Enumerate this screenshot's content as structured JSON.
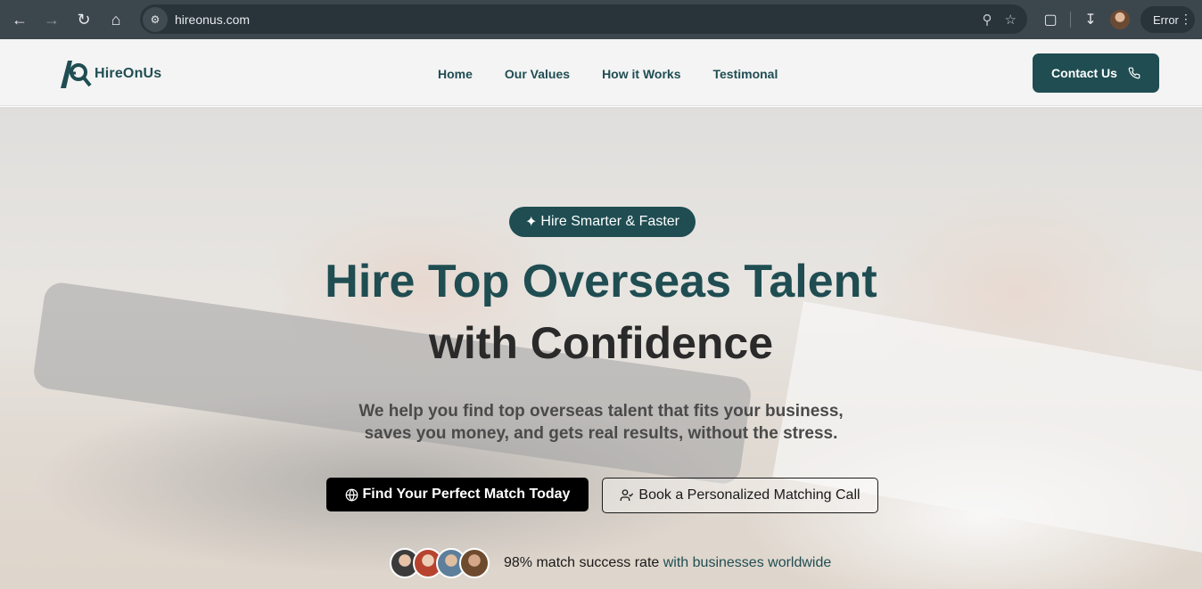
{
  "browser": {
    "url": "hireonus.com",
    "profile_status": "Error",
    "icons": [
      "back-icon",
      "forward-icon",
      "reload-icon",
      "home-icon",
      "site-info-icon",
      "zoom-icon",
      "bookmark-star-icon",
      "extensions-icon",
      "downloads-icon",
      "kebab-menu-icon"
    ]
  },
  "header": {
    "logo_text": "HireOnUs",
    "nav": [
      "Home",
      "Our Values",
      "How it Works",
      "Testimonal"
    ],
    "contact_label": "Contact Us"
  },
  "hero": {
    "badge": "Hire Smarter & Faster",
    "title_line1": "Hire Top Overseas Talent",
    "title_line2": "with Confidence",
    "subtitle_line1": "We help you find top overseas talent that fits your business,",
    "subtitle_line2": "saves you money, and gets real results, without the stress.",
    "cta_primary": "Find Your Perfect Match Today",
    "cta_secondary": "Book a Personalized Matching Call",
    "proof_text": "98% match success rate",
    "proof_highlight": "with businesses worldwide"
  },
  "colors": {
    "brand": "#1f4d52",
    "chrome": "#3c474d",
    "cta_primary_bg": "#000000"
  }
}
